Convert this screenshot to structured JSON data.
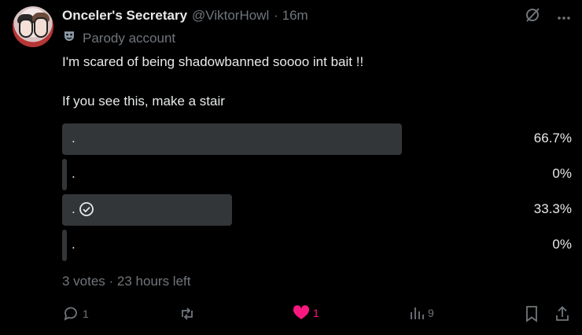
{
  "post": {
    "display_name": "Onceler's Secretary",
    "handle": "@ViktorHowl",
    "time": "· 16m",
    "parody_label": "Parody account",
    "text_line1": "I'm scared of being shadowbanned soooo int bait !!",
    "text_line2": "If you see this, make a stair"
  },
  "poll": {
    "options": [
      {
        "label": ".",
        "percent": "66.7%",
        "fraction": 0.667,
        "selected": false
      },
      {
        "label": ".",
        "percent": "0%",
        "fraction": 0.0,
        "selected": false
      },
      {
        "label": ".",
        "percent": "33.3%",
        "fraction": 0.333,
        "selected": true
      },
      {
        "label": ".",
        "percent": "0%",
        "fraction": 0.0,
        "selected": false
      }
    ],
    "meta": "3 votes · 23 hours left"
  },
  "actions": {
    "replies": "1",
    "reposts": "",
    "likes": "1",
    "views": "9"
  },
  "colors": {
    "background": "#000000",
    "text": "#e7e9ea",
    "muted": "#71767b",
    "bar": "#333639",
    "like": "#f91880"
  },
  "icons": [
    "grok-icon",
    "more-icon",
    "parody-mask-icon",
    "checkmark-circle-icon",
    "reply-icon",
    "repost-icon",
    "heart-icon",
    "views-icon",
    "bookmark-icon",
    "share-icon"
  ]
}
